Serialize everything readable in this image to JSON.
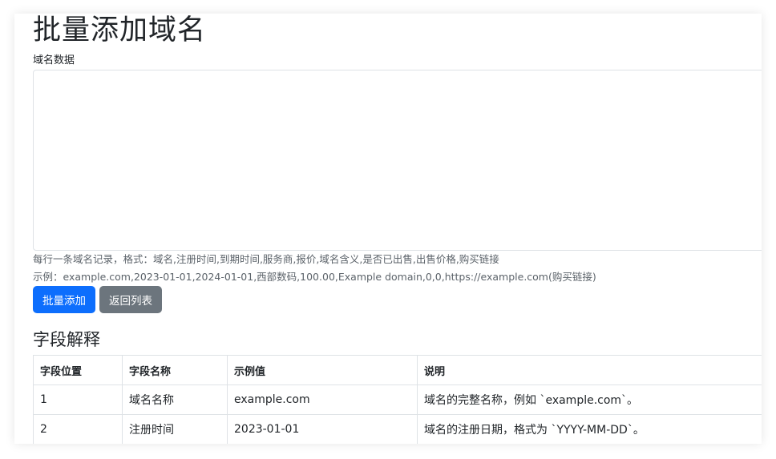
{
  "page_title": "批量添加域名",
  "field_label": "域名数据",
  "textarea_value": "",
  "help_format": "每行一条域名记录，格式：域名,注册时间,到期时间,服务商,报价,域名含义,是否已出售,出售价格,购买链接",
  "help_example": "示例：example.com,2023-01-01,2024-01-01,西部数码,100.00,Example domain,0,0,https://example.com(购买链接)",
  "buttons": {
    "submit": "批量添加",
    "back": "返回列表"
  },
  "section_title": "字段解释",
  "table": {
    "headers": [
      "字段位置",
      "字段名称",
      "示例值",
      "说明"
    ],
    "rows": [
      [
        "1",
        "域名名称",
        "example.com",
        "域名的完整名称，例如 `example.com`。"
      ],
      [
        "2",
        "注册时间",
        "2023-01-01",
        "域名的注册日期，格式为 `YYYY-MM-DD`。"
      ]
    ]
  },
  "colors": {
    "primary": "#0d6efd",
    "secondary": "#6c757d",
    "border": "#dee2e6",
    "muted_text": "#5c636a"
  }
}
